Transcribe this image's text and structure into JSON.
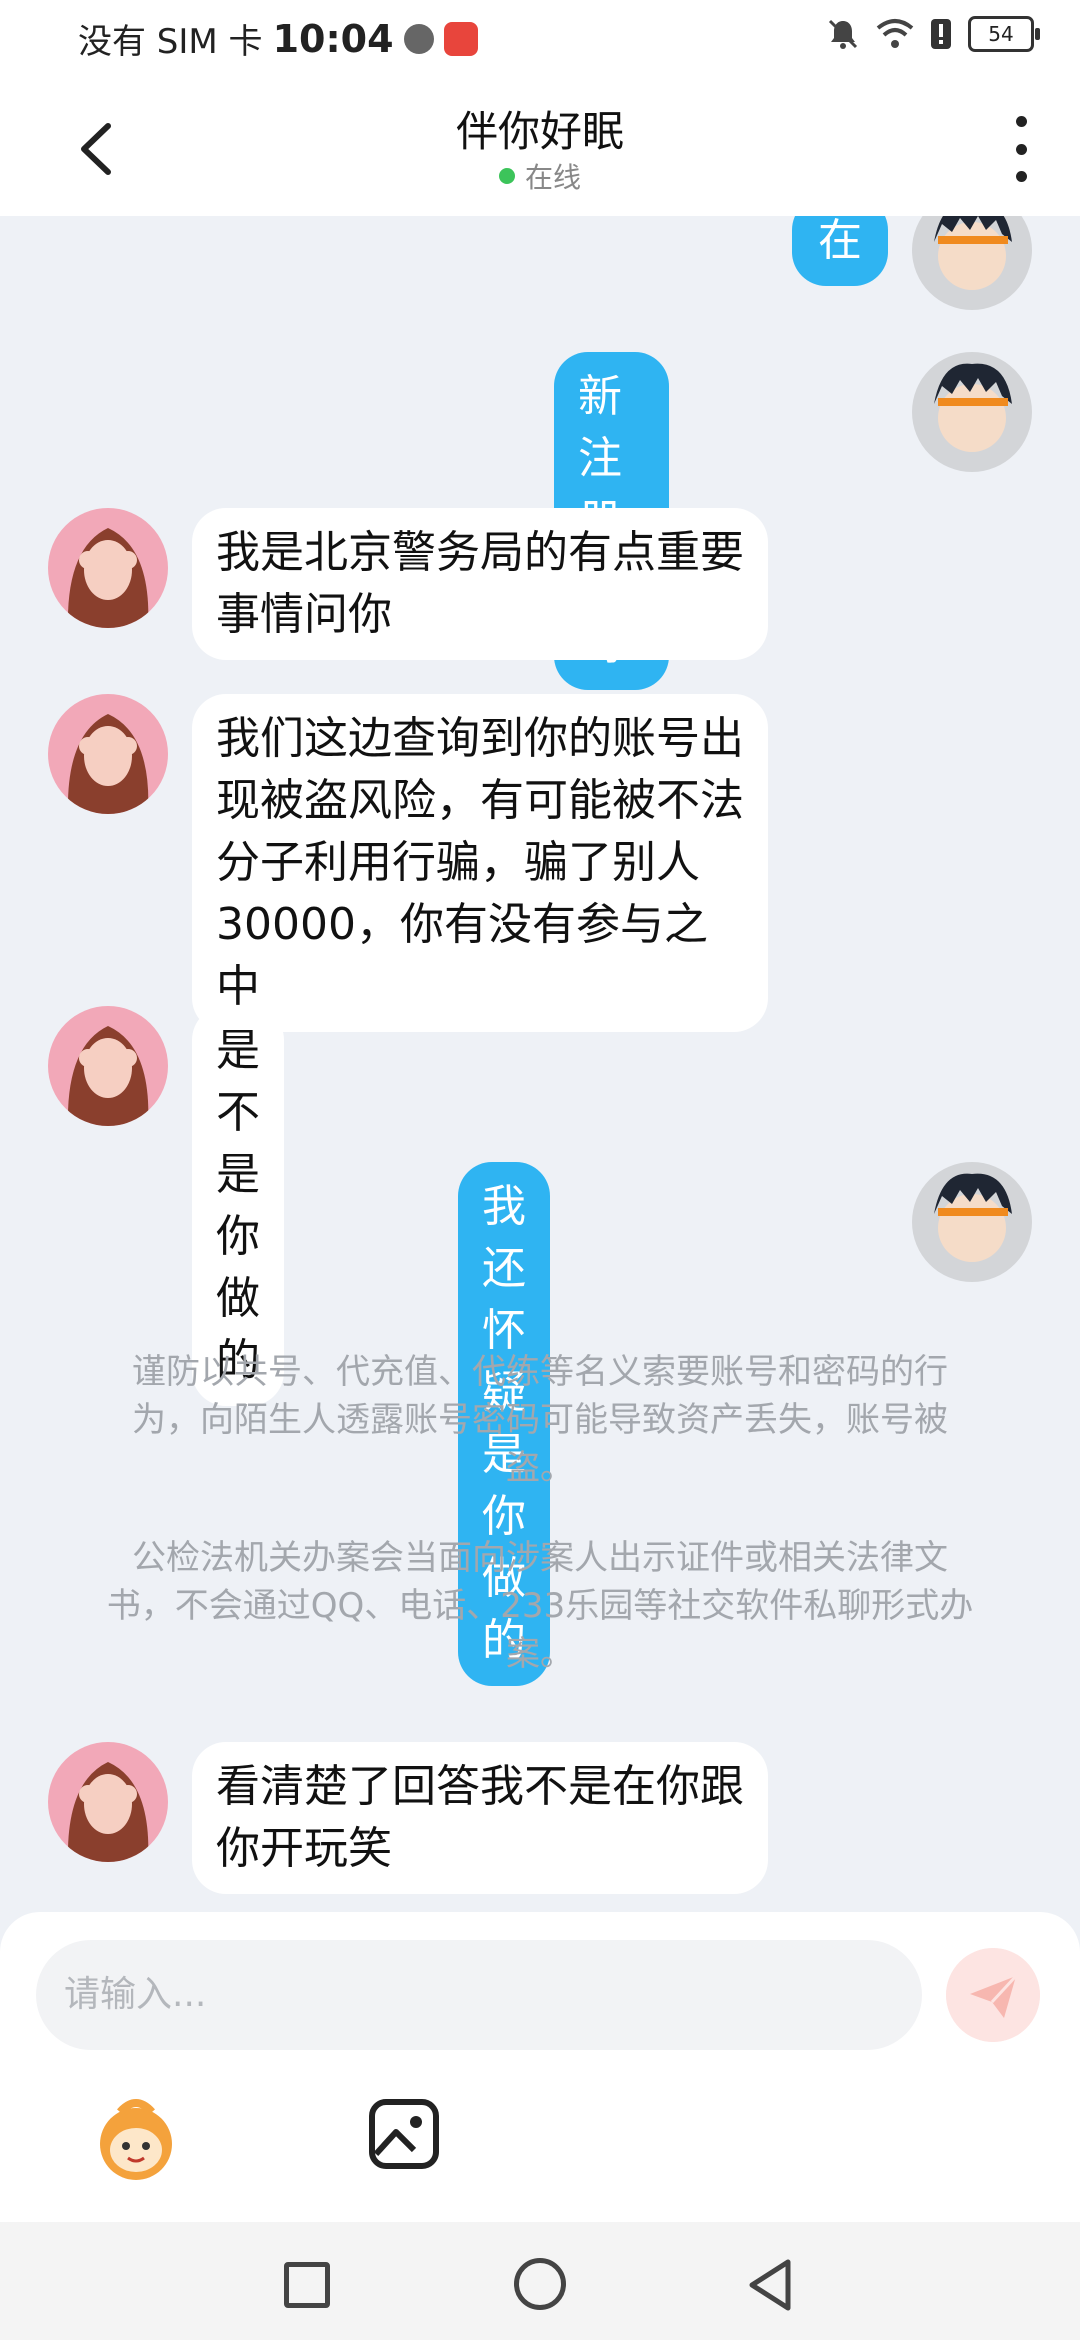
{
  "status_bar": {
    "carrier": "没有 SIM 卡",
    "time": "10:04",
    "battery": "54"
  },
  "header": {
    "title": "伴你好眠",
    "status": "在线"
  },
  "messages": [
    {
      "side": "out",
      "text": "在"
    },
    {
      "side": "out",
      "text": "新注册的吗?"
    },
    {
      "side": "in",
      "text": "我是北京警务局的有点重要事情问你"
    },
    {
      "side": "in",
      "text": "我们这边查询到你的账号出现被盗风险，有可能被不法分子利用行骗，骗了别人30000，你有没有参与之中"
    },
    {
      "side": "in",
      "text": "是不是你做的"
    },
    {
      "side": "out",
      "text": "我还怀疑是你做的"
    },
    {
      "side": "in",
      "text": "看清楚了回答我不是在你跟你开玩笑"
    }
  ],
  "notices": [
    "谨防以共号、代充值、代练等名义索要账号和密码的行为，向陌生人透露账号密码可能导致资产丢失，账号被盗。",
    "公检法机关办案会当面向涉案人出示证件或相关法律文书，不会通过QQ、电话、233乐园等社交软件私聊形式办案。"
  ],
  "input": {
    "placeholder": "请输入..."
  },
  "colors": {
    "outgoing_bubble": "#2fb4f2",
    "incoming_bubble": "#ffffff",
    "background": "#eef1f6",
    "online_dot": "#3cc45a"
  },
  "icons": [
    "back-arrow-icon",
    "more-vertical-icon",
    "send-icon",
    "emoji-mascot-icon",
    "image-icon",
    "recent-apps-icon",
    "home-icon",
    "back-nav-icon"
  ]
}
